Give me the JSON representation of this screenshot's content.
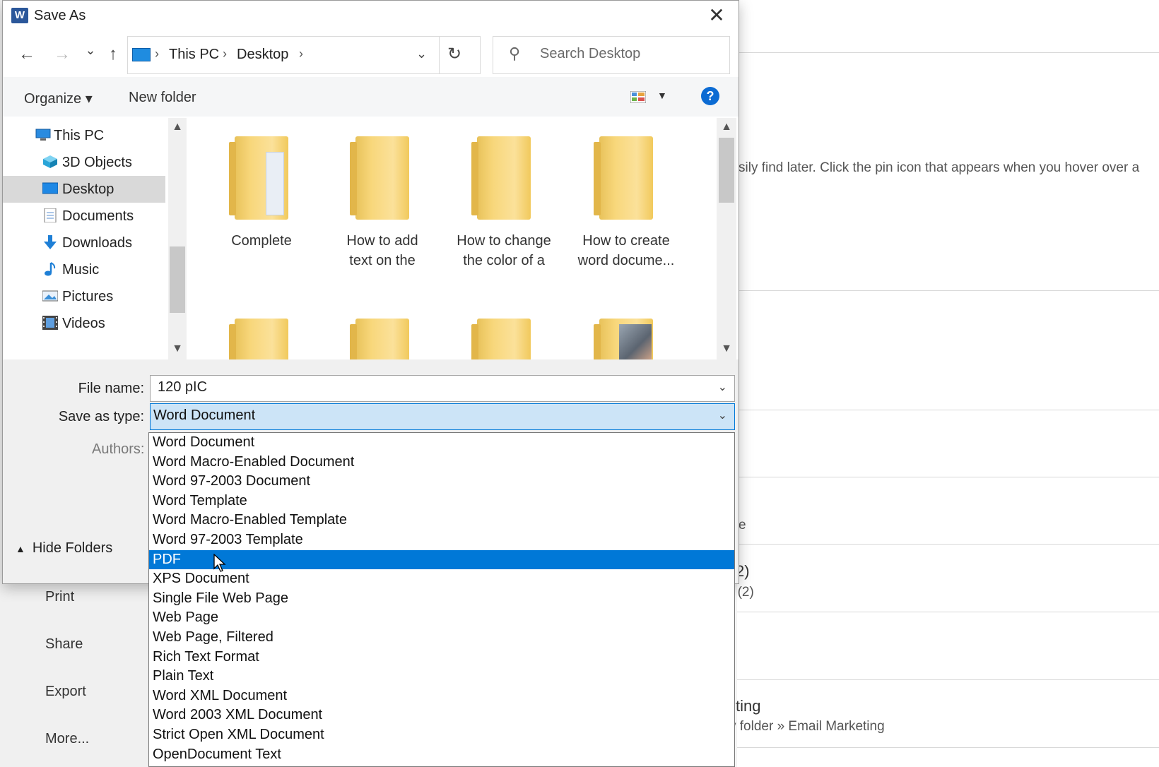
{
  "background": {
    "nav": [
      "Print",
      "Share",
      "Export",
      "More..."
    ],
    "fragments": {
      "pin_hint": "sily find later. Click the pin icon that appears when you hover over a",
      "e": "e",
      "count_title": "2)",
      "count_sub": "r (2)",
      "ting": "ting",
      "path": "v folder » Email Marketing"
    }
  },
  "dialog": {
    "title": "Save As",
    "title_icon": "W",
    "close_glyph": "✕",
    "nav": {
      "back": "←",
      "forward": "→",
      "recent": "⌄",
      "up": "↑"
    },
    "address": {
      "crumbs": [
        "This PC",
        "Desktop"
      ],
      "sep": "›",
      "dropdown": "⌄",
      "refresh": "↻"
    },
    "search": {
      "placeholder": "Search Desktop",
      "icon": "⚲"
    },
    "toolbar": {
      "organize": "Organize ▾",
      "new_folder": "New folder",
      "view_dd": "▼",
      "help": "?"
    },
    "tree": [
      {
        "label": "This PC",
        "icon": "pc-icon"
      },
      {
        "label": "3D Objects",
        "icon": "cube-icon"
      },
      {
        "label": "Desktop",
        "icon": "desktop-icon",
        "selected": true
      },
      {
        "label": "Documents",
        "icon": "document-icon"
      },
      {
        "label": "Downloads",
        "icon": "download-icon"
      },
      {
        "label": "Music",
        "icon": "music-icon"
      },
      {
        "label": "Pictures",
        "icon": "picture-icon"
      },
      {
        "label": "Videos",
        "icon": "video-icon"
      }
    ],
    "folders": [
      {
        "name": "Complete"
      },
      {
        "name": "How to add\ntext on the"
      },
      {
        "name": "How to change\nthe color of a"
      },
      {
        "name": "How to create\nword docume..."
      }
    ],
    "form": {
      "filename_label": "File name:",
      "filename_value": "120 pIC",
      "savetype_label": "Save as type:",
      "savetype_value": "Word Document",
      "authors_label": "Authors:",
      "hide_folders": "Hide Folders",
      "chevron": "⌄"
    },
    "save_types": [
      "Word Document",
      "Word Macro-Enabled Document",
      "Word 97-2003 Document",
      "Word Template",
      "Word Macro-Enabled Template",
      "Word 97-2003 Template",
      "PDF",
      "XPS Document",
      "Single File Web Page",
      "Web Page",
      "Web Page, Filtered",
      "Rich Text Format",
      "Plain Text",
      "Word XML Document",
      "Word 2003 XML Document",
      "Strict Open XML Document",
      "OpenDocument Text"
    ],
    "highlighted_type": "PDF",
    "colors": {
      "accent": "#0078d7",
      "selected_tree_bg": "#d9d9d9",
      "folder_yellow": "#f8d77b",
      "help_blue": "#0b6bd3"
    }
  }
}
